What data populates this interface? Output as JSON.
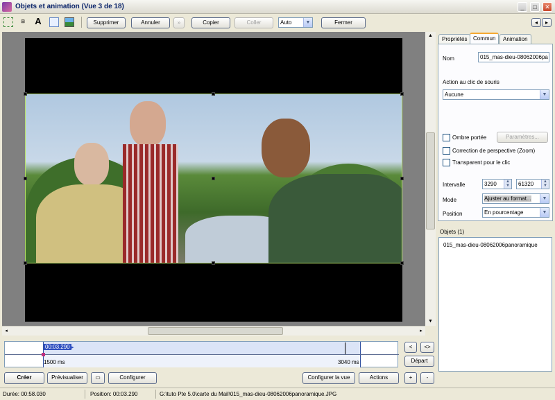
{
  "window": {
    "title": "Objets et animation  (Vue 3 de 18)",
    "controls": {
      "minimize": "_",
      "maximize": "□",
      "close": "✕"
    }
  },
  "toolbar": {
    "supprimer": "Supprimer",
    "annuler": "Annuler",
    "copier": "Copier",
    "coller": "Coller",
    "mode_value": "Auto",
    "fermer": "Fermer",
    "nav_prev": "◂",
    "nav_next": "▸"
  },
  "tabs": [
    "Propriétés",
    "Commun",
    "Animation"
  ],
  "properties": {
    "nom_label": "Nom",
    "nom_value": "015_mas-dieu-08062006pa",
    "action_label": "Action au clic de souris",
    "action_value": "Aucune",
    "ombre_label": "Ombre portée",
    "parametres": "Paramètres...",
    "correction_label": "Correction de perspective (Zoom)",
    "transparent_label": "Transparent pour le clic",
    "intervalle_label": "Intervalle",
    "intervalle_start": "3290",
    "intervalle_end": "61320",
    "mode_label": "Mode",
    "mode_value": "Ajuster au format...",
    "position_label": "Position",
    "position_value": "En pourcentage"
  },
  "objects": {
    "header": "Objets (1)",
    "items": [
      "015_mas-dieu-08062006panoramique"
    ]
  },
  "timeline": {
    "time_marker": "00:03.290",
    "start_label": "1500 ms",
    "end_label": "3040 ms",
    "zoom_out": "<",
    "zoom_in": "<>",
    "depart": "Départ"
  },
  "bottom_buttons": {
    "creer": "Créer",
    "previsualiser": "Prévisualiser",
    "configurer": "Configurer",
    "configurer_vue": "Configurer la vue",
    "actions": "Actions",
    "add": "+",
    "remove": "-"
  },
  "status": {
    "duree": "Durée: 00:58.030",
    "position": "Position: 00:03.290",
    "path": "G:\\tuto Pte 5.0\\carte du Mail\\015_mas-dieu-08062006panoramique.JPG"
  },
  "colors": {
    "title_bar": "#0a246a",
    "selection": "#b5e066",
    "timeline_range": "#dbe4f7"
  }
}
